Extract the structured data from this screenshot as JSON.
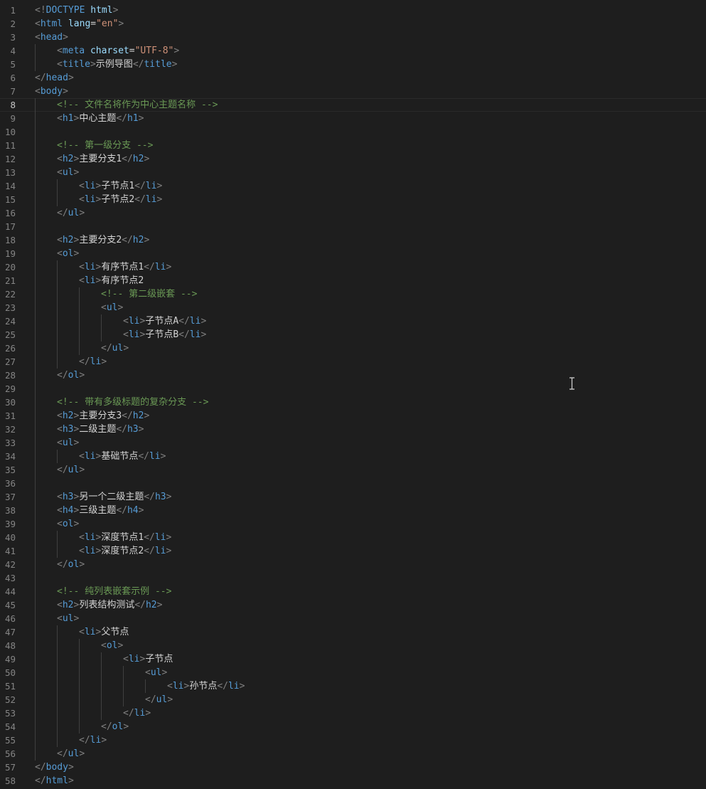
{
  "editor": {
    "language": "html",
    "current_line": 8,
    "colors": {
      "background": "#1e1e1e",
      "tag": "#569cd6",
      "attribute": "#9cdcfe",
      "string": "#ce9178",
      "comment": "#6a9955",
      "text": "#d4d4d4",
      "punctuation": "#808080",
      "line_number": "#858585"
    },
    "lines": [
      {
        "n": "1",
        "indent": 0,
        "tokens": [
          [
            "p",
            "<!"
          ],
          [
            "t",
            "DOCTYPE"
          ],
          [
            "x",
            " "
          ],
          [
            "a",
            "html"
          ],
          [
            "p",
            ">"
          ]
        ]
      },
      {
        "n": "2",
        "indent": 0,
        "tokens": [
          [
            "p",
            "<"
          ],
          [
            "t",
            "html"
          ],
          [
            "x",
            " "
          ],
          [
            "a",
            "lang"
          ],
          [
            "x",
            "="
          ],
          [
            "s",
            "\"en\""
          ],
          [
            "p",
            ">"
          ]
        ]
      },
      {
        "n": "3",
        "indent": 0,
        "tokens": [
          [
            "p",
            "<"
          ],
          [
            "t",
            "head"
          ],
          [
            "p",
            ">"
          ]
        ]
      },
      {
        "n": "4",
        "indent": 1,
        "tokens": [
          [
            "p",
            "<"
          ],
          [
            "t",
            "meta"
          ],
          [
            "x",
            " "
          ],
          [
            "a",
            "charset"
          ],
          [
            "x",
            "="
          ],
          [
            "s",
            "\"UTF-8\""
          ],
          [
            "p",
            ">"
          ]
        ]
      },
      {
        "n": "5",
        "indent": 1,
        "tokens": [
          [
            "p",
            "<"
          ],
          [
            "t",
            "title"
          ],
          [
            "p",
            ">"
          ],
          [
            "x",
            "示例导图"
          ],
          [
            "p",
            "</"
          ],
          [
            "t",
            "title"
          ],
          [
            "p",
            ">"
          ]
        ]
      },
      {
        "n": "6",
        "indent": 0,
        "tokens": [
          [
            "p",
            "</"
          ],
          [
            "t",
            "head"
          ],
          [
            "p",
            ">"
          ]
        ]
      },
      {
        "n": "7",
        "indent": 0,
        "tokens": [
          [
            "p",
            "<"
          ],
          [
            "t",
            "body"
          ],
          [
            "p",
            ">"
          ]
        ]
      },
      {
        "n": "8",
        "indent": 1,
        "tokens": [
          [
            "c",
            "<!-- 文件名将作为中心主题名称 -->"
          ]
        ]
      },
      {
        "n": "9",
        "indent": 1,
        "tokens": [
          [
            "p",
            "<"
          ],
          [
            "t",
            "h1"
          ],
          [
            "p",
            ">"
          ],
          [
            "x",
            "中心主题"
          ],
          [
            "p",
            "</"
          ],
          [
            "t",
            "h1"
          ],
          [
            "p",
            ">"
          ]
        ]
      },
      {
        "n": "10",
        "indent": 1,
        "tokens": []
      },
      {
        "n": "11",
        "indent": 1,
        "tokens": [
          [
            "c",
            "<!-- 第一级分支 -->"
          ]
        ]
      },
      {
        "n": "12",
        "indent": 1,
        "tokens": [
          [
            "p",
            "<"
          ],
          [
            "t",
            "h2"
          ],
          [
            "p",
            ">"
          ],
          [
            "x",
            "主要分支1"
          ],
          [
            "p",
            "</"
          ],
          [
            "t",
            "h2"
          ],
          [
            "p",
            ">"
          ]
        ]
      },
      {
        "n": "13",
        "indent": 1,
        "tokens": [
          [
            "p",
            "<"
          ],
          [
            "t",
            "ul"
          ],
          [
            "p",
            ">"
          ]
        ]
      },
      {
        "n": "14",
        "indent": 2,
        "tokens": [
          [
            "p",
            "<"
          ],
          [
            "t",
            "li"
          ],
          [
            "p",
            ">"
          ],
          [
            "x",
            "子节点1"
          ],
          [
            "p",
            "</"
          ],
          [
            "t",
            "li"
          ],
          [
            "p",
            ">"
          ]
        ]
      },
      {
        "n": "15",
        "indent": 2,
        "tokens": [
          [
            "p",
            "<"
          ],
          [
            "t",
            "li"
          ],
          [
            "p",
            ">"
          ],
          [
            "x",
            "子节点2"
          ],
          [
            "p",
            "</"
          ],
          [
            "t",
            "li"
          ],
          [
            "p",
            ">"
          ]
        ]
      },
      {
        "n": "16",
        "indent": 1,
        "tokens": [
          [
            "p",
            "</"
          ],
          [
            "t",
            "ul"
          ],
          [
            "p",
            ">"
          ]
        ]
      },
      {
        "n": "17",
        "indent": 1,
        "tokens": []
      },
      {
        "n": "18",
        "indent": 1,
        "tokens": [
          [
            "p",
            "<"
          ],
          [
            "t",
            "h2"
          ],
          [
            "p",
            ">"
          ],
          [
            "x",
            "主要分支2"
          ],
          [
            "p",
            "</"
          ],
          [
            "t",
            "h2"
          ],
          [
            "p",
            ">"
          ]
        ]
      },
      {
        "n": "19",
        "indent": 1,
        "tokens": [
          [
            "p",
            "<"
          ],
          [
            "t",
            "ol"
          ],
          [
            "p",
            ">"
          ]
        ]
      },
      {
        "n": "20",
        "indent": 2,
        "tokens": [
          [
            "p",
            "<"
          ],
          [
            "t",
            "li"
          ],
          [
            "p",
            ">"
          ],
          [
            "x",
            "有序节点1"
          ],
          [
            "p",
            "</"
          ],
          [
            "t",
            "li"
          ],
          [
            "p",
            ">"
          ]
        ]
      },
      {
        "n": "21",
        "indent": 2,
        "tokens": [
          [
            "p",
            "<"
          ],
          [
            "t",
            "li"
          ],
          [
            "p",
            ">"
          ],
          [
            "x",
            "有序节点2"
          ]
        ]
      },
      {
        "n": "22",
        "indent": 3,
        "tokens": [
          [
            "c",
            "<!-- 第二级嵌套 -->"
          ]
        ]
      },
      {
        "n": "23",
        "indent": 3,
        "tokens": [
          [
            "p",
            "<"
          ],
          [
            "t",
            "ul"
          ],
          [
            "p",
            ">"
          ]
        ]
      },
      {
        "n": "24",
        "indent": 4,
        "tokens": [
          [
            "p",
            "<"
          ],
          [
            "t",
            "li"
          ],
          [
            "p",
            ">"
          ],
          [
            "x",
            "子节点A"
          ],
          [
            "p",
            "</"
          ],
          [
            "t",
            "li"
          ],
          [
            "p",
            ">"
          ]
        ]
      },
      {
        "n": "25",
        "indent": 4,
        "tokens": [
          [
            "p",
            "<"
          ],
          [
            "t",
            "li"
          ],
          [
            "p",
            ">"
          ],
          [
            "x",
            "子节点B"
          ],
          [
            "p",
            "</"
          ],
          [
            "t",
            "li"
          ],
          [
            "p",
            ">"
          ]
        ]
      },
      {
        "n": "26",
        "indent": 3,
        "tokens": [
          [
            "p",
            "</"
          ],
          [
            "t",
            "ul"
          ],
          [
            "p",
            ">"
          ]
        ]
      },
      {
        "n": "27",
        "indent": 2,
        "tokens": [
          [
            "p",
            "</"
          ],
          [
            "t",
            "li"
          ],
          [
            "p",
            ">"
          ]
        ]
      },
      {
        "n": "28",
        "indent": 1,
        "tokens": [
          [
            "p",
            "</"
          ],
          [
            "t",
            "ol"
          ],
          [
            "p",
            ">"
          ]
        ]
      },
      {
        "n": "29",
        "indent": 1,
        "tokens": []
      },
      {
        "n": "30",
        "indent": 1,
        "tokens": [
          [
            "c",
            "<!-- 带有多级标题的复杂分支 -->"
          ]
        ]
      },
      {
        "n": "31",
        "indent": 1,
        "tokens": [
          [
            "p",
            "<"
          ],
          [
            "t",
            "h2"
          ],
          [
            "p",
            ">"
          ],
          [
            "x",
            "主要分支3"
          ],
          [
            "p",
            "</"
          ],
          [
            "t",
            "h2"
          ],
          [
            "p",
            ">"
          ]
        ]
      },
      {
        "n": "32",
        "indent": 1,
        "tokens": [
          [
            "p",
            "<"
          ],
          [
            "t",
            "h3"
          ],
          [
            "p",
            ">"
          ],
          [
            "x",
            "二级主题"
          ],
          [
            "p",
            "</"
          ],
          [
            "t",
            "h3"
          ],
          [
            "p",
            ">"
          ]
        ]
      },
      {
        "n": "33",
        "indent": 1,
        "tokens": [
          [
            "p",
            "<"
          ],
          [
            "t",
            "ul"
          ],
          [
            "p",
            ">"
          ]
        ]
      },
      {
        "n": "34",
        "indent": 2,
        "tokens": [
          [
            "p",
            "<"
          ],
          [
            "t",
            "li"
          ],
          [
            "p",
            ">"
          ],
          [
            "x",
            "基础节点"
          ],
          [
            "p",
            "</"
          ],
          [
            "t",
            "li"
          ],
          [
            "p",
            ">"
          ]
        ]
      },
      {
        "n": "35",
        "indent": 1,
        "tokens": [
          [
            "p",
            "</"
          ],
          [
            "t",
            "ul"
          ],
          [
            "p",
            ">"
          ]
        ]
      },
      {
        "n": "36",
        "indent": 1,
        "tokens": []
      },
      {
        "n": "37",
        "indent": 1,
        "tokens": [
          [
            "p",
            "<"
          ],
          [
            "t",
            "h3"
          ],
          [
            "p",
            ">"
          ],
          [
            "x",
            "另一个二级主题"
          ],
          [
            "p",
            "</"
          ],
          [
            "t",
            "h3"
          ],
          [
            "p",
            ">"
          ]
        ]
      },
      {
        "n": "38",
        "indent": 1,
        "tokens": [
          [
            "p",
            "<"
          ],
          [
            "t",
            "h4"
          ],
          [
            "p",
            ">"
          ],
          [
            "x",
            "三级主题"
          ],
          [
            "p",
            "</"
          ],
          [
            "t",
            "h4"
          ],
          [
            "p",
            ">"
          ]
        ]
      },
      {
        "n": "39",
        "indent": 1,
        "tokens": [
          [
            "p",
            "<"
          ],
          [
            "t",
            "ol"
          ],
          [
            "p",
            ">"
          ]
        ]
      },
      {
        "n": "40",
        "indent": 2,
        "tokens": [
          [
            "p",
            "<"
          ],
          [
            "t",
            "li"
          ],
          [
            "p",
            ">"
          ],
          [
            "x",
            "深度节点1"
          ],
          [
            "p",
            "</"
          ],
          [
            "t",
            "li"
          ],
          [
            "p",
            ">"
          ]
        ]
      },
      {
        "n": "41",
        "indent": 2,
        "tokens": [
          [
            "p",
            "<"
          ],
          [
            "t",
            "li"
          ],
          [
            "p",
            ">"
          ],
          [
            "x",
            "深度节点2"
          ],
          [
            "p",
            "</"
          ],
          [
            "t",
            "li"
          ],
          [
            "p",
            ">"
          ]
        ]
      },
      {
        "n": "42",
        "indent": 1,
        "tokens": [
          [
            "p",
            "</"
          ],
          [
            "t",
            "ol"
          ],
          [
            "p",
            ">"
          ]
        ]
      },
      {
        "n": "43",
        "indent": 1,
        "tokens": []
      },
      {
        "n": "44",
        "indent": 1,
        "tokens": [
          [
            "c",
            "<!-- 纯列表嵌套示例 -->"
          ]
        ]
      },
      {
        "n": "45",
        "indent": 1,
        "tokens": [
          [
            "p",
            "<"
          ],
          [
            "t",
            "h2"
          ],
          [
            "p",
            ">"
          ],
          [
            "x",
            "列表结构测试"
          ],
          [
            "p",
            "</"
          ],
          [
            "t",
            "h2"
          ],
          [
            "p",
            ">"
          ]
        ]
      },
      {
        "n": "46",
        "indent": 1,
        "tokens": [
          [
            "p",
            "<"
          ],
          [
            "t",
            "ul"
          ],
          [
            "p",
            ">"
          ]
        ]
      },
      {
        "n": "47",
        "indent": 2,
        "tokens": [
          [
            "p",
            "<"
          ],
          [
            "t",
            "li"
          ],
          [
            "p",
            ">"
          ],
          [
            "x",
            "父节点"
          ]
        ]
      },
      {
        "n": "48",
        "indent": 3,
        "tokens": [
          [
            "p",
            "<"
          ],
          [
            "t",
            "ol"
          ],
          [
            "p",
            ">"
          ]
        ]
      },
      {
        "n": "49",
        "indent": 4,
        "tokens": [
          [
            "p",
            "<"
          ],
          [
            "t",
            "li"
          ],
          [
            "p",
            ">"
          ],
          [
            "x",
            "子节点"
          ]
        ]
      },
      {
        "n": "50",
        "indent": 5,
        "tokens": [
          [
            "p",
            "<"
          ],
          [
            "t",
            "ul"
          ],
          [
            "p",
            ">"
          ]
        ]
      },
      {
        "n": "51",
        "indent": 6,
        "tokens": [
          [
            "p",
            "<"
          ],
          [
            "t",
            "li"
          ],
          [
            "p",
            ">"
          ],
          [
            "x",
            "孙节点"
          ],
          [
            "p",
            "</"
          ],
          [
            "t",
            "li"
          ],
          [
            "p",
            ">"
          ]
        ]
      },
      {
        "n": "52",
        "indent": 5,
        "tokens": [
          [
            "p",
            "</"
          ],
          [
            "t",
            "ul"
          ],
          [
            "p",
            ">"
          ]
        ]
      },
      {
        "n": "53",
        "indent": 4,
        "tokens": [
          [
            "p",
            "</"
          ],
          [
            "t",
            "li"
          ],
          [
            "p",
            ">"
          ]
        ]
      },
      {
        "n": "54",
        "indent": 3,
        "tokens": [
          [
            "p",
            "</"
          ],
          [
            "t",
            "ol"
          ],
          [
            "p",
            ">"
          ]
        ]
      },
      {
        "n": "55",
        "indent": 2,
        "tokens": [
          [
            "p",
            "</"
          ],
          [
            "t",
            "li"
          ],
          [
            "p",
            ">"
          ]
        ]
      },
      {
        "n": "56",
        "indent": 1,
        "tokens": [
          [
            "p",
            "</"
          ],
          [
            "t",
            "ul"
          ],
          [
            "p",
            ">"
          ]
        ]
      },
      {
        "n": "57",
        "indent": 0,
        "tokens": [
          [
            "p",
            "</"
          ],
          [
            "t",
            "body"
          ],
          [
            "p",
            ">"
          ]
        ]
      },
      {
        "n": "58",
        "indent": 0,
        "tokens": [
          [
            "p",
            "</"
          ],
          [
            "t",
            "html"
          ],
          [
            "p",
            ">"
          ]
        ]
      }
    ],
    "guides": {
      "10": 1,
      "17": 1,
      "29": 1,
      "36": 1,
      "43": 1,
      "21": 2,
      "47": 2,
      "49": 4,
      "53": 4
    },
    "mouse_cursor_icon": "text-ibeam-cursor-icon"
  }
}
